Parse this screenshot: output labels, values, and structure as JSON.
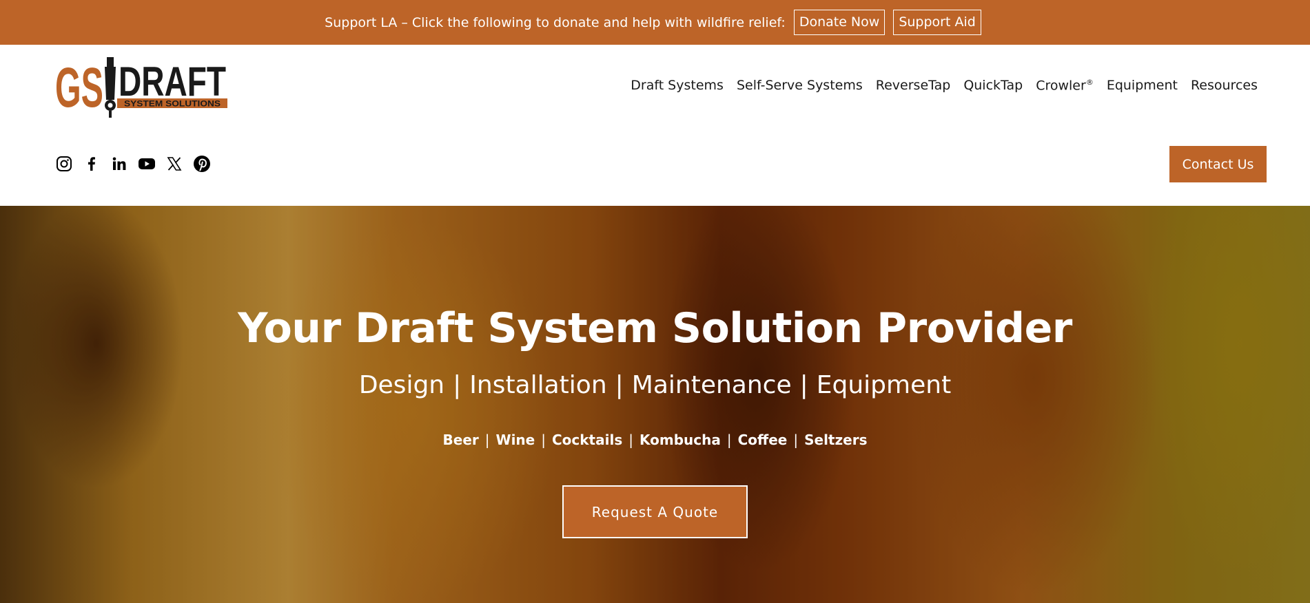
{
  "banner": {
    "text": "Support LA – Click the following to donate and help with wildfire relief:",
    "donate_label": "Donate Now",
    "aid_label": "Support Aid"
  },
  "logo": {
    "left_text": "GS",
    "right_text": "DRAFT",
    "tagline": "SYSTEM SOLUTIONS"
  },
  "nav": {
    "items": [
      "Draft Systems",
      "Self-Serve Systems",
      "ReverseTap",
      "QuickTap",
      "Crowler",
      "Equipment",
      "Resources"
    ],
    "crowler_mark": "®"
  },
  "socials": [
    "instagram-icon",
    "facebook-icon",
    "linkedin-icon",
    "youtube-icon",
    "x-icon",
    "pinterest-icon"
  ],
  "contact_label": "Contact Us",
  "hero": {
    "title": "Your Draft System Solution Provider",
    "services": [
      "Design",
      "Installation",
      "Maintenance",
      "Equipment"
    ],
    "drinks": [
      "Beer",
      "Wine",
      "Cocktails",
      "Kombucha",
      "Coffee",
      "Seltzers"
    ],
    "separator": "|",
    "cta_label": "Request A Quote"
  },
  "colors": {
    "brand": "#bd6428",
    "text_dark": "#1a1a1a"
  }
}
